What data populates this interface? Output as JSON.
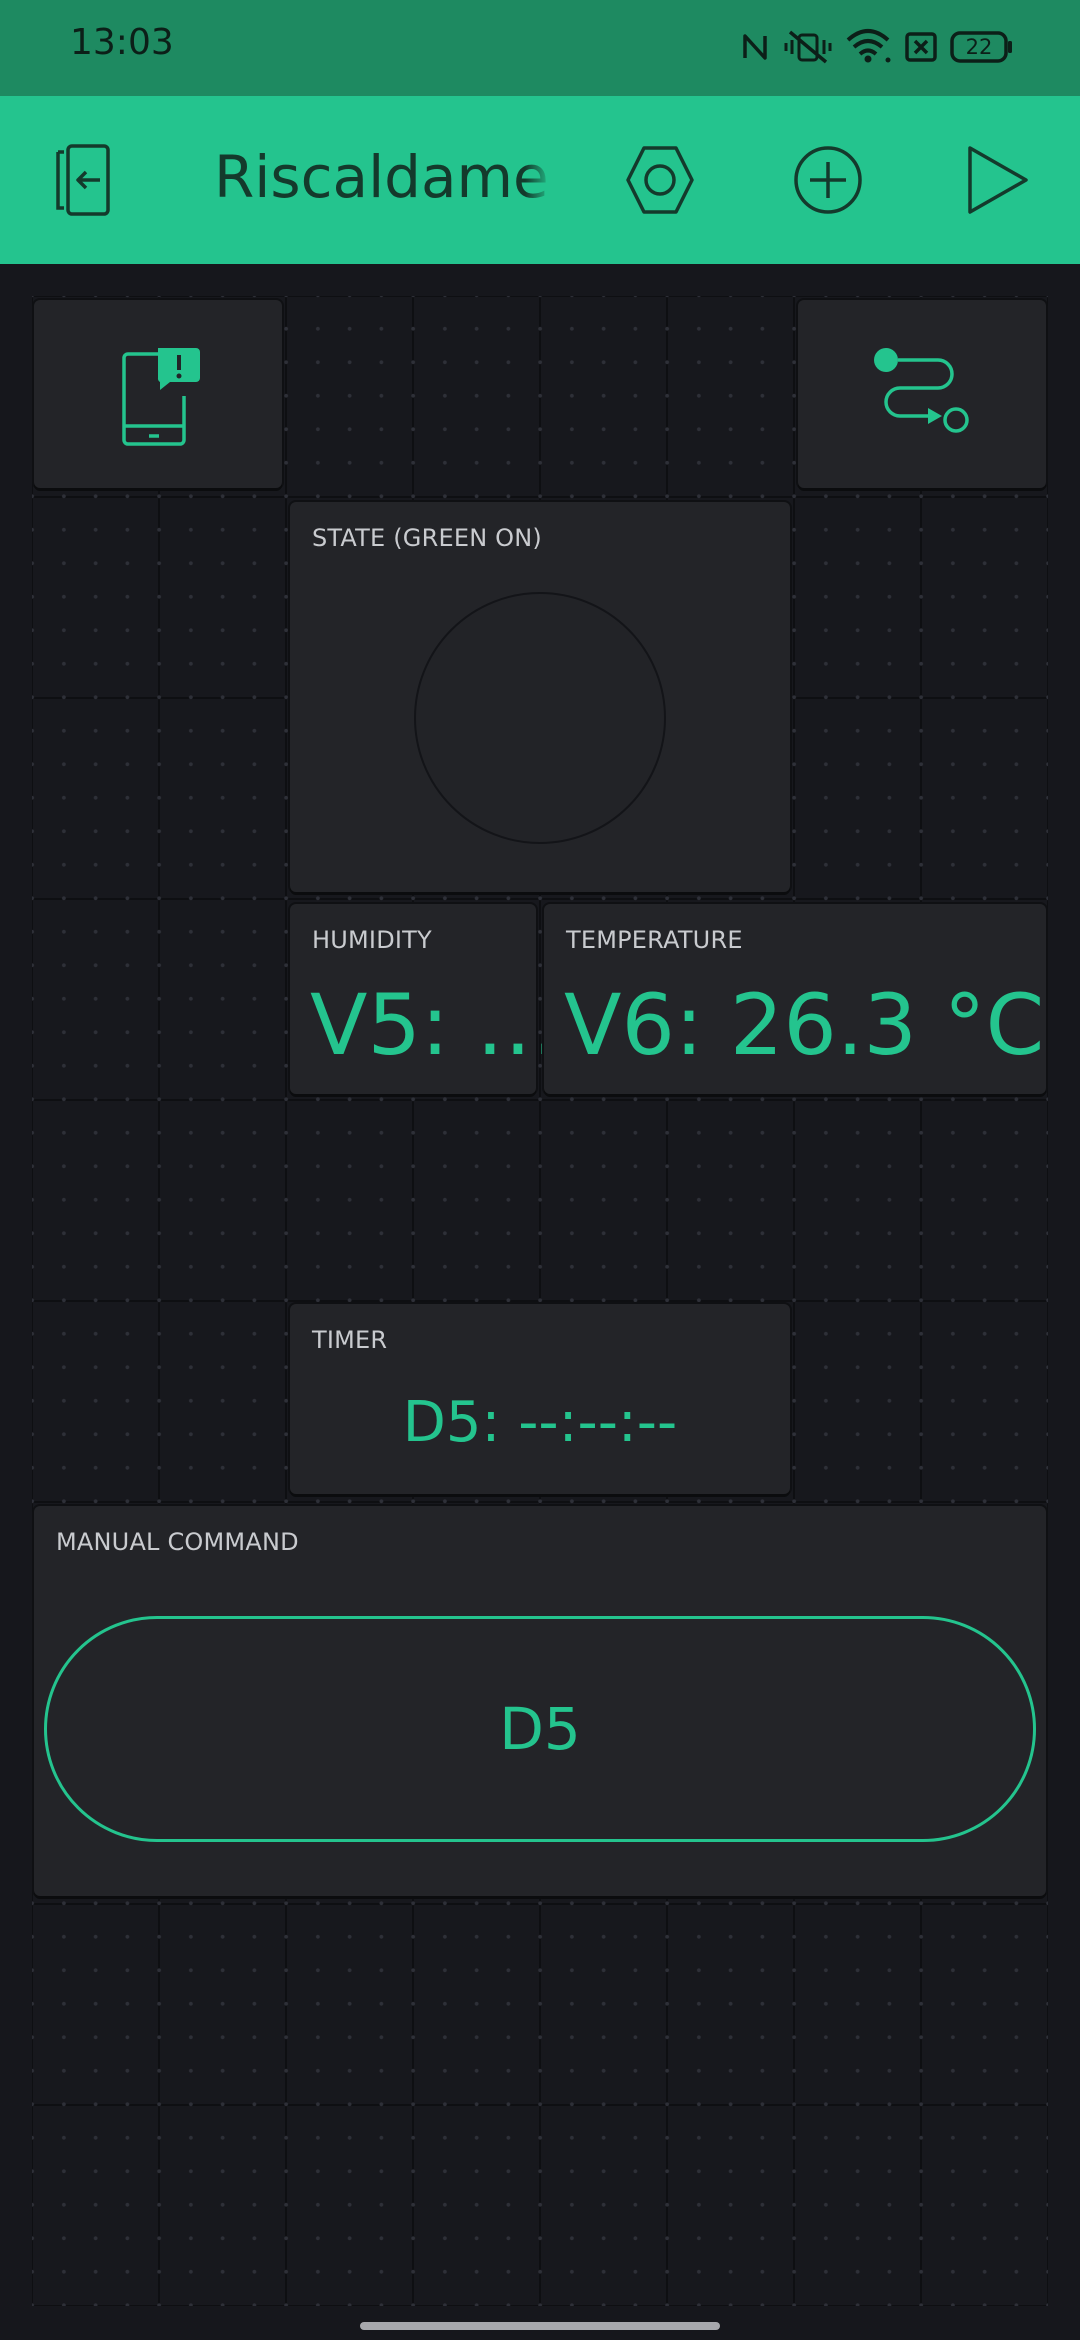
{
  "status_bar": {
    "time": "13:03",
    "battery_level": "22",
    "icons": [
      "nfc-icon",
      "vibrate-mute-icon",
      "wifi-icon",
      "sim-x-icon",
      "battery-icon"
    ]
  },
  "top_bar": {
    "title": "Riscaldamento",
    "icons": [
      "exit-icon",
      "settings-hexnut-icon",
      "add-widget-icon",
      "play-icon"
    ]
  },
  "widgets": {
    "notification": {
      "icon": "phone-notification-icon"
    },
    "eventor": {
      "icon": "eventor-route-icon"
    },
    "state_led": {
      "label": "STATE (GREEN ON)"
    },
    "humidity": {
      "label": "HUMIDITY",
      "value": "V5: …"
    },
    "temperature": {
      "label": "TEMPERATURE",
      "value": "V6: 26.3 °C"
    },
    "timer": {
      "label": "TIMER",
      "value": "D5: --:--:--"
    },
    "manual_command": {
      "label": "MANUAL COMMAND",
      "button_label": "D5"
    }
  },
  "colors": {
    "accent": "#24c48e",
    "status_bar_bg": "#1e8a61",
    "canvas_bg": "#17181d",
    "widget_bg": "#232428",
    "label_text": "#c9cbcf"
  }
}
